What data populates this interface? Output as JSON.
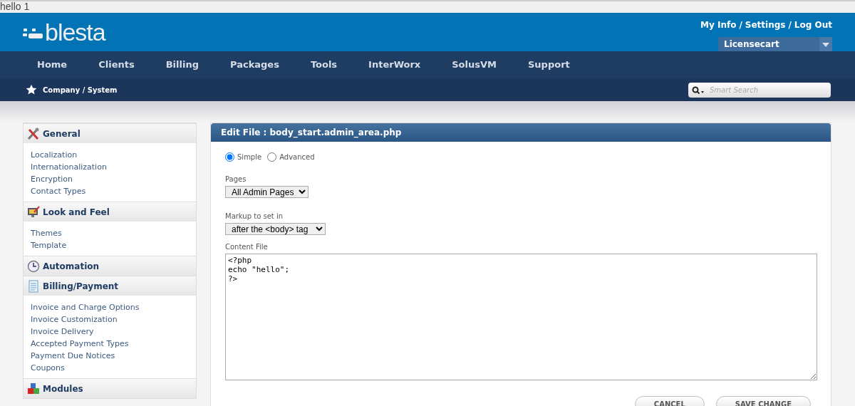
{
  "browser_text": "hello 1",
  "header": {
    "logo": "blesta",
    "user_links": [
      "My Info",
      "Settings",
      "Log Out"
    ],
    "link_separator": "/",
    "company_select": {
      "value": "Licensecart"
    }
  },
  "nav": [
    {
      "label": "Home",
      "selected": false
    },
    {
      "label": "Clients",
      "selected": false
    },
    {
      "label": "Billing",
      "selected": false
    },
    {
      "label": "Packages",
      "selected": false
    },
    {
      "label": "Tools",
      "selected": false
    },
    {
      "label": "InterWorx",
      "selected": false
    },
    {
      "label": "SolusVM",
      "selected": false
    },
    {
      "label": "Support",
      "selected": false
    }
  ],
  "breadcrumb": "Company / System",
  "search": {
    "placeholder": "Smart Search"
  },
  "sidebar": [
    {
      "title": "General",
      "items": [
        "Localization",
        "Internationalization",
        "Encryption",
        "Contact Types"
      ]
    },
    {
      "title": "Look and Feel",
      "items": [
        "Themes",
        "Template"
      ]
    },
    {
      "title": "Automation"
    },
    {
      "title": "Billing/Payment",
      "items": [
        "Invoice and Charge Options",
        "Invoice Customization",
        "Invoice Delivery",
        "Accepted Payment Types",
        "Payment Due Notices",
        "Coupons"
      ]
    },
    {
      "title": "Modules"
    }
  ],
  "panel": {
    "title": "Edit File : body_start.admin_area.php",
    "mode": [
      {
        "label": "Simple",
        "selected": true
      },
      {
        "label": "Advanced",
        "selected": false
      }
    ],
    "pages": {
      "label": "Pages",
      "value": "All Admin Pages"
    },
    "markup": {
      "label": "Markup to set in",
      "value": "after the <body> tag"
    },
    "content_file": {
      "label": "Content File",
      "value": "<?php\necho \"hello\";\n?>"
    },
    "buttons": [
      "CANCEL",
      "SAVE CHANGE"
    ]
  }
}
